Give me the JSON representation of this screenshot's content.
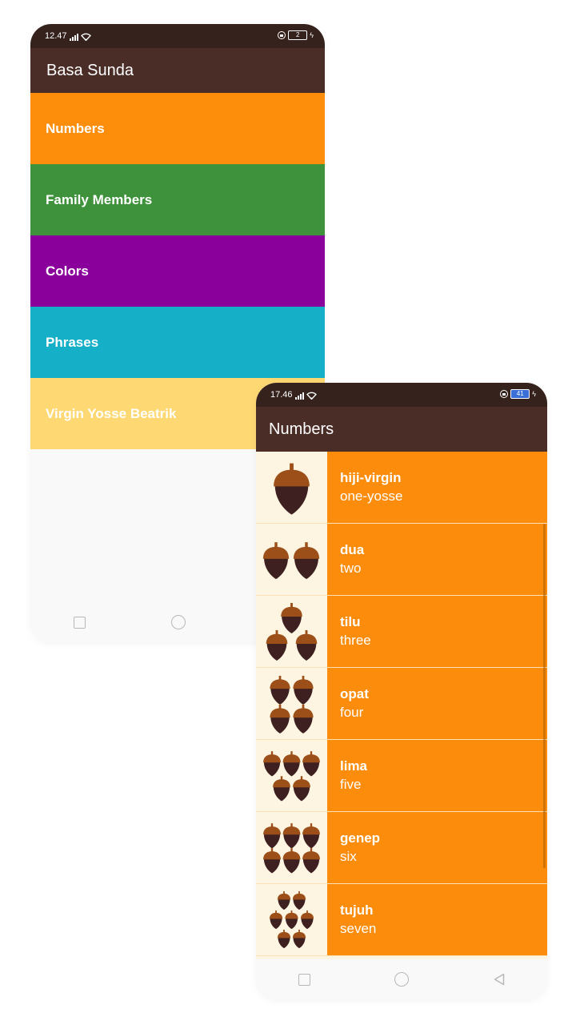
{
  "phone_main": {
    "status_time": "12.47",
    "battery": "2",
    "app_title": "Basa Sunda",
    "categories": [
      {
        "label": "Numbers",
        "color": "#fd8e0c"
      },
      {
        "label": "Family Members",
        "color": "#3d923b"
      },
      {
        "label": "Colors",
        "color": "#8a009b"
      },
      {
        "label": "Phrases",
        "color": "#16afc8"
      },
      {
        "label": "Virgin Yosse Beatrik",
        "color": "#fdd873"
      }
    ]
  },
  "phone_numbers": {
    "status_time": "17.46",
    "battery": "41",
    "screen_title": "Numbers",
    "items": [
      {
        "sunda": "hiji-virgin",
        "english": "one-yosse",
        "acorn_count": 1
      },
      {
        "sunda": "dua",
        "english": "two",
        "acorn_count": 2
      },
      {
        "sunda": "tilu",
        "english": "three",
        "acorn_count": 3
      },
      {
        "sunda": "opat",
        "english": "four",
        "acorn_count": 4
      },
      {
        "sunda": "lima",
        "english": "five",
        "acorn_count": 5
      },
      {
        "sunda": "genep",
        "english": "six",
        "acorn_count": 6
      },
      {
        "sunda": "tujuh",
        "english": "seven",
        "acorn_count": 7
      }
    ]
  },
  "colors": {
    "status_bar": "#35221c",
    "toolbar": "#4b2d27",
    "item_background": "#fb8c0c",
    "image_background": "#fdf5e1",
    "acorn_cap": "#9c4f18",
    "acorn_nut": "#3e2020"
  },
  "icons": {
    "nav": [
      "square-icon",
      "circle-icon",
      "back-triangle-icon"
    ],
    "number_image": "acorn-icon"
  }
}
